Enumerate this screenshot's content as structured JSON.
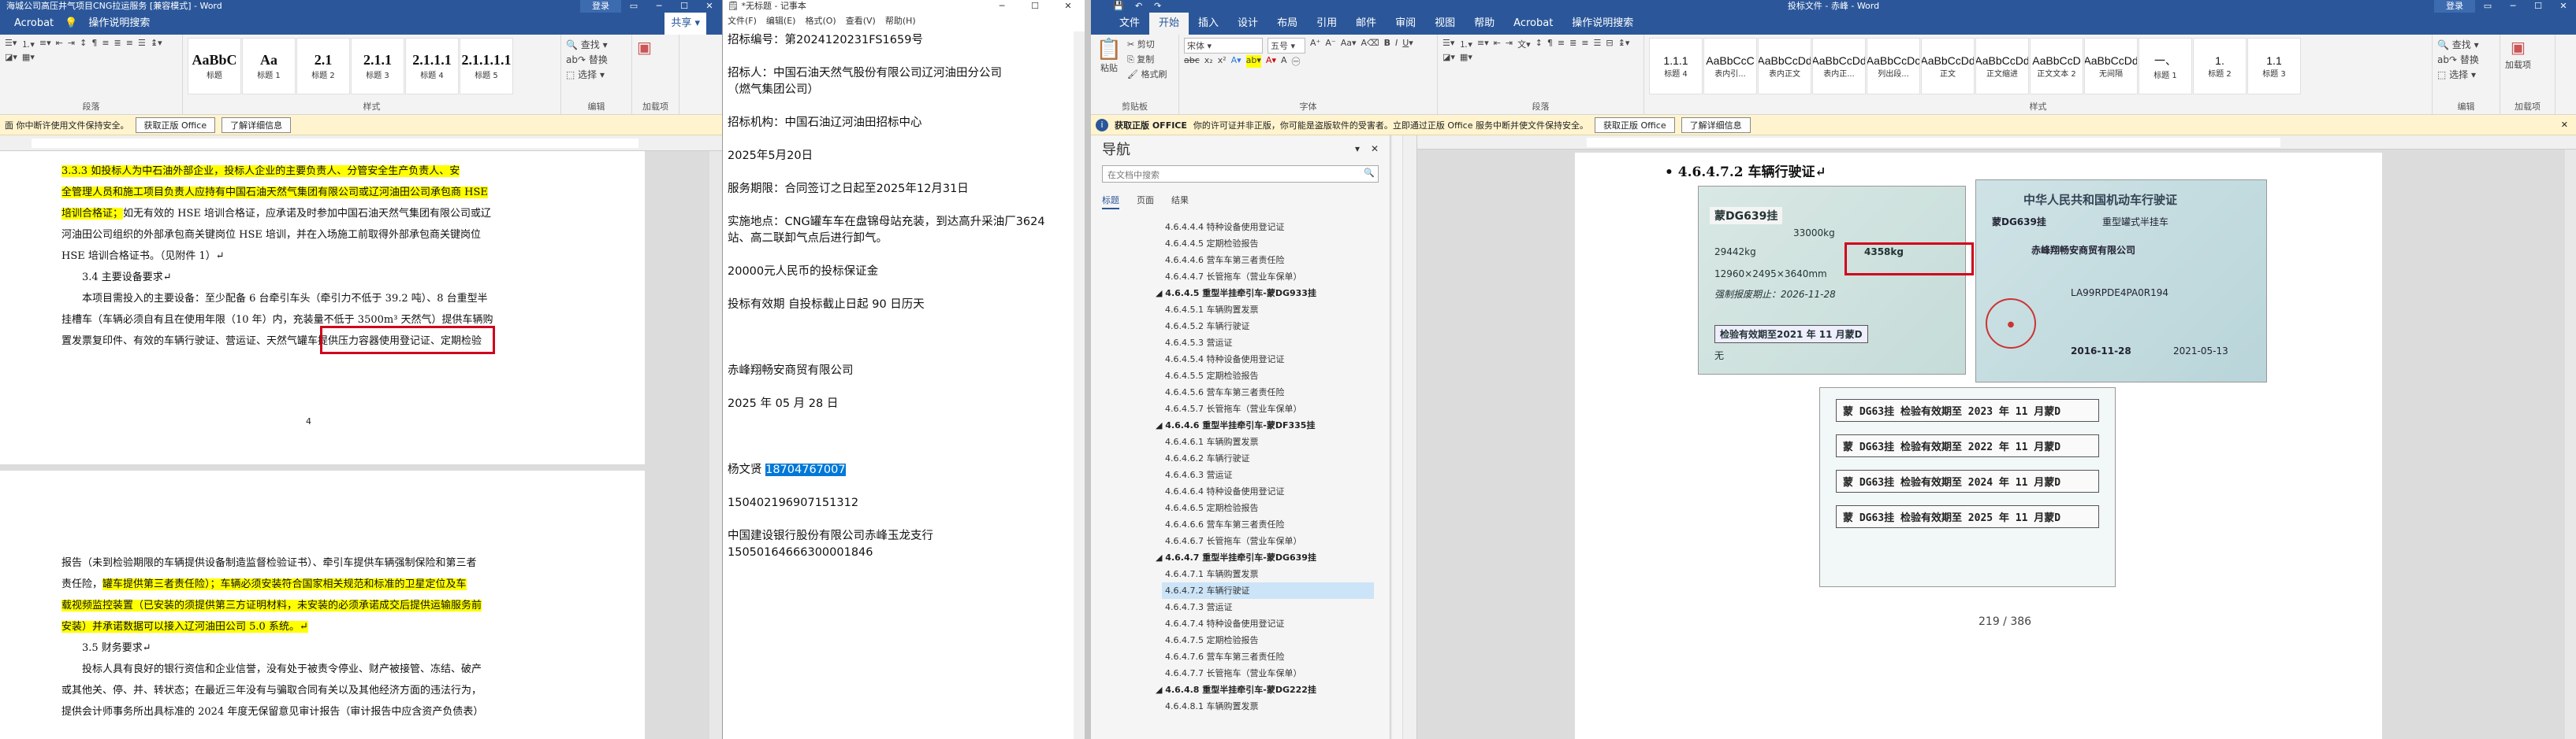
{
  "win1": {
    "title": "海城公司高压井气项目CNG拉运服务 [兼容模式] - Word",
    "signin": "登录",
    "share": "共享",
    "qa": "Acrobat",
    "tellme": "操作说明搜索",
    "styles": [
      {
        "p": "AaBbC",
        "n": "标题"
      },
      {
        "p": "Aa",
        "n": "标题 1"
      },
      {
        "p": "2.1",
        "n": "标题 2"
      },
      {
        "p": "2.1.1",
        "n": "标题 3"
      },
      {
        "p": "2.1.1.1",
        "n": "标题 4"
      },
      {
        "p": "2.1.1.1.1",
        "n": "标题 5"
      }
    ],
    "find": "查找",
    "replace": "替换",
    "select": "选择",
    "grp_para": "段落",
    "grp_style": "样式",
    "grp_edit": "编辑",
    "grp_acro": "加载项",
    "warn": "面 你中断许使用文件保持安全。",
    "warn_btn1": "获取正版 Office",
    "warn_btn2": "了解详细信息",
    "p1_lines": [
      {
        "t": "3.3.3 如投标人为中石油外部企业，投标人企业的主要负责人、分管安全生产负责人、安",
        "hl": true
      },
      {
        "t": "全管理人员和施工项目负责人应持有中国石油天然气集团有限公司或辽河油田公司承包商 HSE",
        "hl": true
      },
      {
        "t": "培训合格证；",
        "hl": true,
        "rest": "如无有效的 HSE 培训合格证，应承诺及时参加中国石油天然气集团有限公司或辽"
      },
      {
        "t": "河油田公司组织的外部承包商关键岗位 HSE 培训，并在入场施工前取得外部承包商关键岗位",
        "hl": false
      },
      {
        "t": "HSE 培训合格证书。（见附件 1）↵",
        "hl": false
      },
      {
        "t": "3.4 主要设备要求↵",
        "hl": false,
        "indent": true
      },
      {
        "t": "本项目需投入的主要设备：至少配备 6 台牵引车头（牵引力不低于 39.2 吨）、8 台重型半",
        "hl": false,
        "indent": true
      },
      {
        "t": "挂槽车（车辆必须自有且在使用年限（10 年）内，充装量不低于 3500m³ 天然气）提供车辆购",
        "hl": false
      },
      {
        "t": "置发票复印件、有效的车辆行驶证、营运证、天然气罐车提供压力容器使用登记证、定期检验",
        "hl": false
      }
    ],
    "p2_lines": [
      {
        "t": "报告（未到检验期限的车辆提供设备制造监督检验证书）、牵引车提供车辆强制保险和第三者",
        "hl": false
      },
      {
        "t": "责任险，",
        "hl": false,
        "rest2": "罐车提供第三者责任险）；车辆必须安装符合国家相关规范和标准的卫星定位及车"
      },
      {
        "t": "载视频监控装置（已安装的须提供第三方证明材料，未安装的必须承诺成交后提供运输服务前",
        "hl": true
      },
      {
        "t": "安装）并承诺数据可以接入辽河油田公司 5.0 系统。↵",
        "hl": true
      },
      {
        "t": "3.5 财务要求↵",
        "hl": false,
        "indent": true
      },
      {
        "t": "投标人具有良好的银行资信和企业信誉，没有处于被责令停业、财产被接管、冻结、破产",
        "hl": false,
        "indent": true
      },
      {
        "t": "或其他关、停、并、转状态；在最近三年没有与骗取合同有关以及其他经济方面的违法行为，",
        "hl": false
      },
      {
        "t": "提供会计师事务所出具标准的 2024 年度无保留意见审计报告（审计报告中应含资产负债表）",
        "hl": false
      }
    ],
    "pagenum": "4"
  },
  "win2": {
    "title": "*无标题 - 记事本",
    "menu": [
      "文件(F)",
      "编辑(E)",
      "格式(O)",
      "查看(V)",
      "帮助(H)"
    ],
    "lines": [
      "招标编号：第2024120231FS1659号",
      "",
      "招标人：中国石油天然气股份有限公司辽河油田分公司",
      "（燃气集团公司）",
      "",
      "招标机构：中国石油辽河油田招标中心",
      "",
      "2025年5月20日",
      "",
      "服务期限：合同签订之日起至2025年12月31日",
      "",
      "实施地点：CNG罐车车在盘锦母站充装，到达高升采油厂3624",
      "站、高二联卸气点后进行卸气。",
      "",
      "20000元人民币的投标保证金",
      "",
      "投标有效期   自投标截止日起  90   日历天",
      "",
      "",
      "",
      "赤峰翔畅安商贸有限公司",
      "",
      "2025 年 05 月 28 日",
      "",
      "",
      ""
    ],
    "phone_label": "杨文贤 ",
    "phone": "18704767007",
    "lines2": [
      "",
      "150402196907151312",
      "",
      "中国建设银行股份有限公司赤峰玉龙支行",
      "15050164666300001846"
    ]
  },
  "win3": {
    "title": "投标文件 - 赤峰 - Word",
    "signin": "登录",
    "tabs": [
      "文件",
      "开始",
      "插入",
      "设计",
      "布局",
      "引用",
      "邮件",
      "审阅",
      "视图",
      "帮助",
      "Acrobat",
      "操作说明搜索"
    ],
    "paste": "粘贴",
    "cut": "剪切",
    "copy": "复制",
    "fmt": "格式刷",
    "font": "宋体",
    "size": "五号",
    "styles": [
      {
        "p": "1.1.1",
        "n": "标题 4"
      },
      {
        "p": "AaBbCcC",
        "n": "表内引..."
      },
      {
        "p": "AaBbCcDd",
        "n": "表内正文"
      },
      {
        "p": "AaBbCcDd",
        "n": "表内正..."
      },
      {
        "p": "AaBbCcDc",
        "n": "列出段..."
      },
      {
        "p": "AaBbCcDd",
        "n": "正文"
      },
      {
        "p": "AaBbCcDd",
        "n": "正文缩进"
      },
      {
        "p": "AaBbCcD",
        "n": "正文文本 2"
      },
      {
        "p": "AaBbCcDd",
        "n": "无间隔"
      },
      {
        "p": "一、",
        "n": "标题 1"
      },
      {
        "p": "1.",
        "n": "标题 2"
      },
      {
        "p": "1.1",
        "n": "标题 3"
      }
    ],
    "find": "查找",
    "replace": "替换",
    "select": "选择",
    "addin": "加载项",
    "grp_clip": "剪贴板",
    "grp_font": "字体",
    "grp_para": "段落",
    "grp_style": "样式",
    "grp_edit": "编辑",
    "grp_addin": "加载项",
    "warn_title": "获取正版 OFFICE",
    "warn": "你的许可证并非正版，你可能是盗版软件的受害者。立即通过正版 Office 服务中断并使文件保持安全。",
    "warn_btn1": "获取正版 Office",
    "warn_btn2": "了解详细信息",
    "nav_title": "导航",
    "nav_search": "在文档中搜索",
    "nav_tabs": [
      "标题",
      "页面",
      "结果"
    ],
    "nav_items": [
      {
        "t": "4.6.4.4.4 特种设备使用登记证",
        "lv": 3
      },
      {
        "t": "4.6.4.4.5 定期检验报告",
        "lv": 3
      },
      {
        "t": "4.6.4.4.6 营车车第三者责任险",
        "lv": 3
      },
      {
        "t": "4.6.4.4.7 长管拖车（营业车保单）",
        "lv": 3
      },
      {
        "t": "4.6.4.5 重型半挂牵引车-蒙DG933挂",
        "lv": 2,
        "h": true
      },
      {
        "t": "4.6.4.5.1 车辆购置发票",
        "lv": 3
      },
      {
        "t": "4.6.4.5.2 车辆行驶证",
        "lv": 3
      },
      {
        "t": "4.6.4.5.3 营运证",
        "lv": 3
      },
      {
        "t": "4.6.4.5.4 特种设备使用登记证",
        "lv": 3
      },
      {
        "t": "4.6.4.5.5 定期检验报告",
        "lv": 3
      },
      {
        "t": "4.6.4.5.6 营车车第三者责任险",
        "lv": 3
      },
      {
        "t": "4.6.4.5.7 长管拖车（营业车保单）",
        "lv": 3
      },
      {
        "t": "4.6.4.6 重型半挂牵引车-蒙DF335挂",
        "lv": 2,
        "h": true
      },
      {
        "t": "4.6.4.6.1 车辆购置发票",
        "lv": 3
      },
      {
        "t": "4.6.4.6.2 车辆行驶证",
        "lv": 3
      },
      {
        "t": "4.6.4.6.3 营运证",
        "lv": 3
      },
      {
        "t": "4.6.4.6.4 特种设备使用登记证",
        "lv": 3
      },
      {
        "t": "4.6.4.6.5 定期检验报告",
        "lv": 3
      },
      {
        "t": "4.6.4.6.6 营车车第三者责任险",
        "lv": 3
      },
      {
        "t": "4.6.4.6.7 长管拖车（营业车保单）",
        "lv": 3
      },
      {
        "t": "4.6.4.7 重型半挂牵引车-蒙DG639挂",
        "lv": 2,
        "h": true
      },
      {
        "t": "4.6.4.7.1 车辆购置发票",
        "lv": 3
      },
      {
        "t": "4.6.4.7.2 车辆行驶证",
        "lv": 3,
        "sel": true
      },
      {
        "t": "4.6.4.7.3 营运证",
        "lv": 3
      },
      {
        "t": "4.6.4.7.4 特种设备使用登记证",
        "lv": 3
      },
      {
        "t": "4.6.4.7.5 定期检验报告",
        "lv": 3
      },
      {
        "t": "4.6.4.7.6 营车车第三者责任险",
        "lv": 3
      },
      {
        "t": "4.6.4.7.7 长管拖车（营业车保单）",
        "lv": 3
      },
      {
        "t": "4.6.4.8 重型半挂牵引车-蒙DG222挂",
        "lv": 2,
        "h": true
      },
      {
        "t": "4.6.4.8.1 车辆购置发票",
        "lv": 3
      }
    ],
    "heading": "4.6.4.7.2 车辆行驶证",
    "card1": {
      "title": "中华人民共和国机动车行驶证",
      "plate": "蒙DG639挂",
      "type": "重型罐式半挂车",
      "owner": "赤峰翔畅安商贸有限公司",
      "date": "2016-11-28",
      "date2": "2021-05-13",
      "vin": "LA99RPDE4PA0R194"
    },
    "card2": {
      "l1": "33000kg",
      "l2": "29442kg",
      "l3": "4358kg",
      "dim": "12960×2495×3640mm",
      "scrap": "强制报废期止：2026-11-28",
      "insp": "检验有效期至2021 年 11 月蒙D",
      "note": "无"
    },
    "stamps": [
      "蒙 DG63挂  检验有效期至 2023 年 11 月蒙D",
      "蒙 DG63挂  检验有效期至 2022 年 11 月蒙D",
      "蒙 DG63挂  检验有效期至 2024 年 11 月蒙D",
      "蒙 DG63挂  检验有效期至 2025 年 11 月蒙D"
    ],
    "pagenum": "219 / 386"
  },
  "colors": {
    "word_blue": "#2b579a",
    "highlight": "#ffff00",
    "red": "#d0021b",
    "select_blue": "#0078d7"
  }
}
